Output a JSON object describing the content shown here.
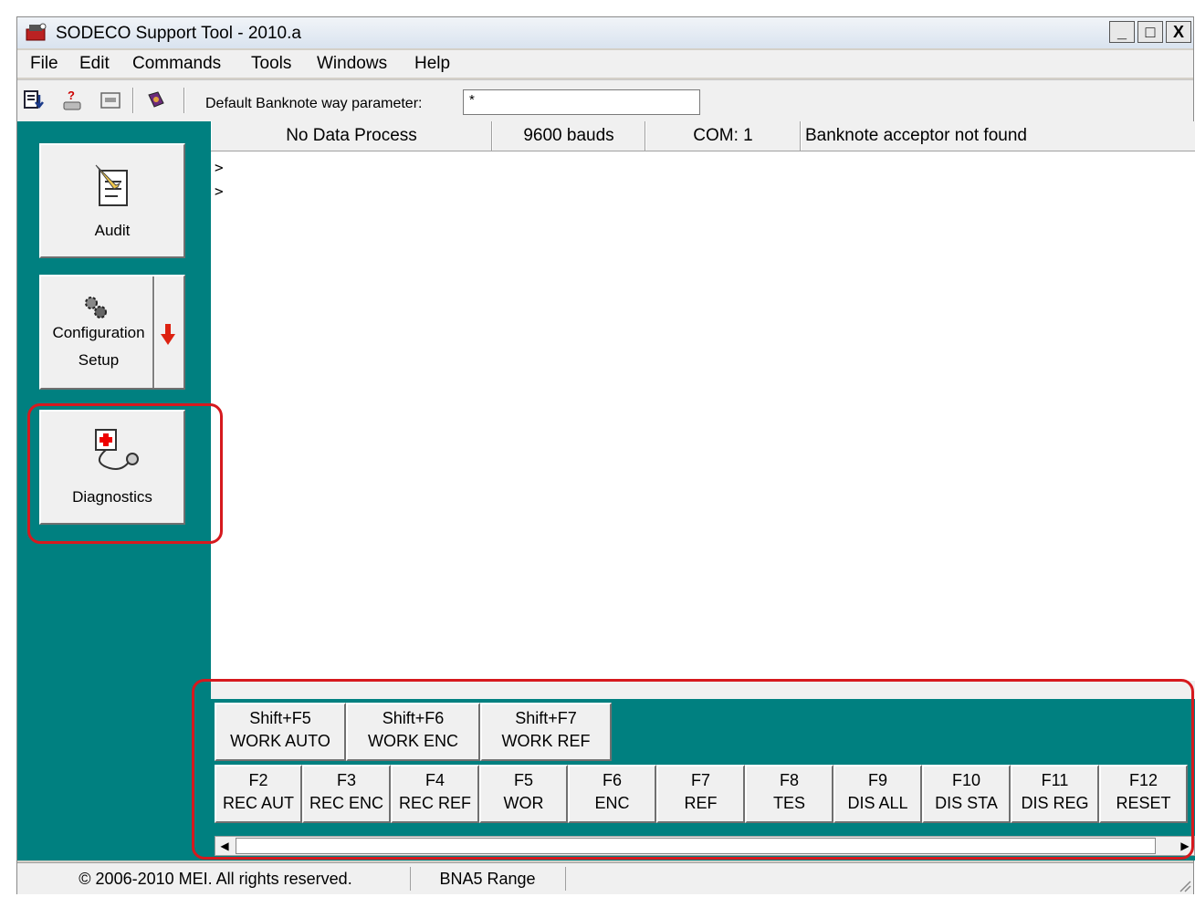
{
  "window": {
    "title": "SODECO Support Tool - 2010.a"
  },
  "titlebar_buttons": [
    "_",
    "□",
    "X"
  ],
  "menu": [
    {
      "label": "File"
    },
    {
      "label": "Edit"
    },
    {
      "label": "Commands"
    },
    {
      "label": "Tools"
    },
    {
      "label": "Windows"
    },
    {
      "label": "Help"
    }
  ],
  "toolbar": {
    "param_label": "Default Banknote way parameter:",
    "param_value": "*",
    "icons": [
      "download-icon",
      "person-help-icon",
      "keyboard-icon",
      "book-icon"
    ]
  },
  "sidebar": {
    "audit": {
      "label": "Audit",
      "icon": "notepad-pencil-icon"
    },
    "configuration": {
      "label1": "Configuration",
      "label2": "Setup",
      "icon": "gears-icon",
      "arrow": "down-arrow-icon"
    },
    "diagnostics": {
      "label": "Diagnostics",
      "icon": "stethoscope-icon"
    }
  },
  "status_row": {
    "process": "No Data Process",
    "bauds": "9600 bauds",
    "com": "COM: 1",
    "acceptor": "Banknote acceptor not found"
  },
  "console": {
    "lines": [
      ">",
      ">"
    ]
  },
  "function_keys_row1": [
    {
      "key": "Shift+F5",
      "label": "WORK AUTO"
    },
    {
      "key": "Shift+F6",
      "label": "WORK ENC"
    },
    {
      "key": "Shift+F7",
      "label": "WORK REF"
    }
  ],
  "function_keys_row2": [
    {
      "key": "F2",
      "label": "REC AUT"
    },
    {
      "key": "F3",
      "label": "REC ENC"
    },
    {
      "key": "F4",
      "label": "REC REF"
    },
    {
      "key": "F5",
      "label": "WOR"
    },
    {
      "key": "F6",
      "label": "ENC"
    },
    {
      "key": "F7",
      "label": "REF"
    },
    {
      "key": "F8",
      "label": "TES"
    },
    {
      "key": "F9",
      "label": "DIS ALL"
    },
    {
      "key": "F10",
      "label": "DIS STA"
    },
    {
      "key": "F11",
      "label": "DIS REG"
    },
    {
      "key": "F12",
      "label": "RESET"
    }
  ],
  "statusbar": {
    "copyright": "© 2006-2010 MEI. All rights reserved.",
    "range": "BNA5 Range"
  },
  "colors": {
    "sidebar": "#008080",
    "highlight": "#d6191e"
  }
}
